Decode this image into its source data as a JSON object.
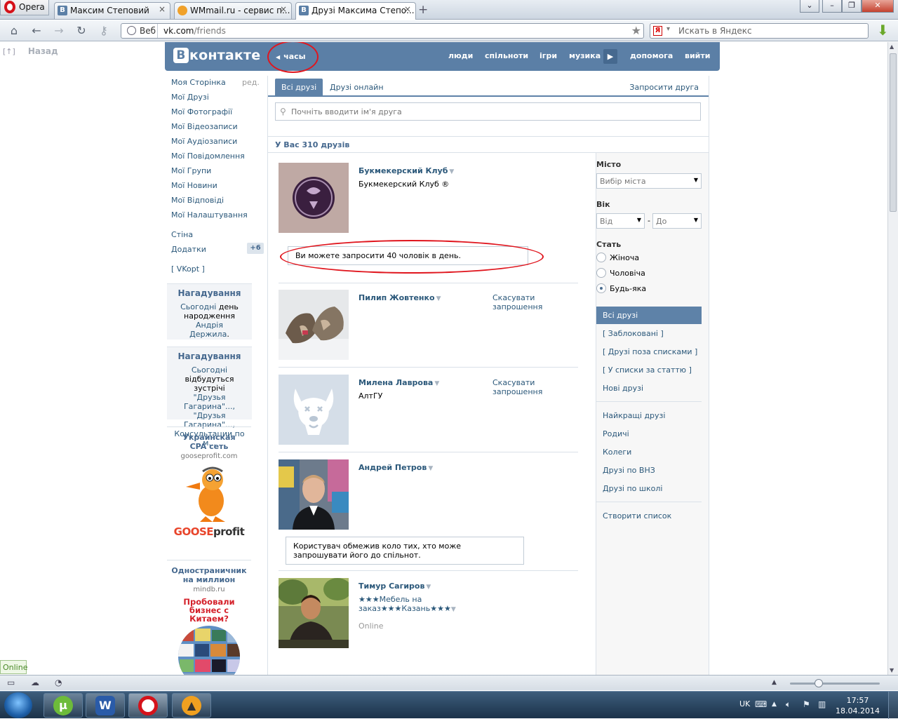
{
  "browser": {
    "menu_label": "Opera",
    "tabs": [
      {
        "label": "Максим Степовий",
        "icon": "vk-icon"
      },
      {
        "label": "WMmail.ru - сервис п...",
        "icon": "wmmail-icon"
      },
      {
        "label": "Друзі Максима Степо...",
        "icon": "vk-icon"
      }
    ],
    "web_label": "Веб",
    "url_domain": "vk.com",
    "url_path": "/friends",
    "search_placeholder": "Искать в Яндекс",
    "back_label": "Назад",
    "back_icon_text": "[↑]"
  },
  "vk": {
    "logo_text": "контакте",
    "logo_letter": "В",
    "audio_label": "часы",
    "nav": [
      "люди",
      "спільноти",
      "ігри",
      "музика",
      "допомога",
      "вийти"
    ]
  },
  "left_menu": {
    "items": [
      "Моя Сторінка",
      "Мої Друзі",
      "Мої Фотографії",
      "Мої Відеозаписи",
      "Мої Аудіозаписи",
      "Мої Повідомлення",
      "Мої Групи",
      "Мої Новини",
      "Мої Відповіді",
      "Мої Налаштування"
    ],
    "edit_label": "ред.",
    "wall": "Стіна",
    "apps": "Додатки",
    "apps_badge": "+6",
    "vkopt": "[ VKopt ]"
  },
  "reminders": [
    {
      "title": "Нагадування",
      "l1": "Сьогодні",
      "l2": " день",
      "l3": "народження ",
      "l4": "Андрія",
      "l5": "Держила",
      "l6": "."
    },
    {
      "title": "Нагадування",
      "l1": "Сьогодні",
      "l2": "відбудуться зустрічі",
      "l3": "\"Друзья Гагарина\"...,",
      "l4": "\"Друзья Гагарина\"...,",
      "l5": "Консультации по м..."
    }
  ],
  "ads": [
    {
      "title": "Украинская CPA сеть",
      "domain": "gooseprofit.com",
      "brand_a": "GOOSE",
      "brand_b": "profit"
    },
    {
      "title": "Одностраничник на миллион",
      "domain": "mindb.ru",
      "promo": "Пробовали бизнес с Китаем?"
    }
  ],
  "center": {
    "tabs": [
      "Всі друзі",
      "Друзі онлайн"
    ],
    "invite_label": "Запросити друга",
    "search_placeholder": "Почніть вводити ім'я друга",
    "count_label": "У Вас 310 друзів",
    "friends": [
      {
        "name": "Букмекерский Клуб",
        "sub": "Букмекерский Клуб ®",
        "action": "",
        "online": ""
      },
      {
        "name": "Пилип Жовтенко",
        "sub": "",
        "action": "Скасувати запрошення",
        "online": ""
      },
      {
        "name": "Милена Лаврова",
        "sub": "АлтГУ",
        "action": "Скасувати запрошення",
        "online": ""
      },
      {
        "name": "Андрей Петров",
        "sub": "",
        "action": "",
        "online": ""
      },
      {
        "name": "Тимур Сагиров",
        "sub": "★★★Мебель на заказ★★★Казань★★★",
        "action": "",
        "online": "Online"
      }
    ],
    "invite_notice": "Ви можете запросити 40 чоловік в день.",
    "restricted_notice": "Користувач обмежив коло тих, хто може запрошувати його до спільнот."
  },
  "filters": {
    "city_label": "Місто",
    "city_placeholder": "Вибір міста",
    "age_label": "Вік",
    "age_from": "Від",
    "age_dash": "-",
    "age_to": "До",
    "sex_label": "Стать",
    "sex_options": [
      "Жіноча",
      "Чоловіча",
      "Будь-яка"
    ],
    "sex_selected": "Будь-яка",
    "lists_a": [
      "Всі друзі",
      "[ Заблоковані ]",
      "[ Друзі поза списками ]",
      "[ У списки за статтю ]",
      "Нові друзі"
    ],
    "lists_b": [
      "Найкращі друзі",
      "Родичі",
      "Колеги",
      "Друзі по ВНЗ",
      "Друзі по школі"
    ],
    "create_list": "Створити список"
  },
  "status": {
    "online_tag": "Online"
  },
  "taskbar": {
    "lang": "UK",
    "time": "17:57",
    "date": "18.04.2014"
  }
}
